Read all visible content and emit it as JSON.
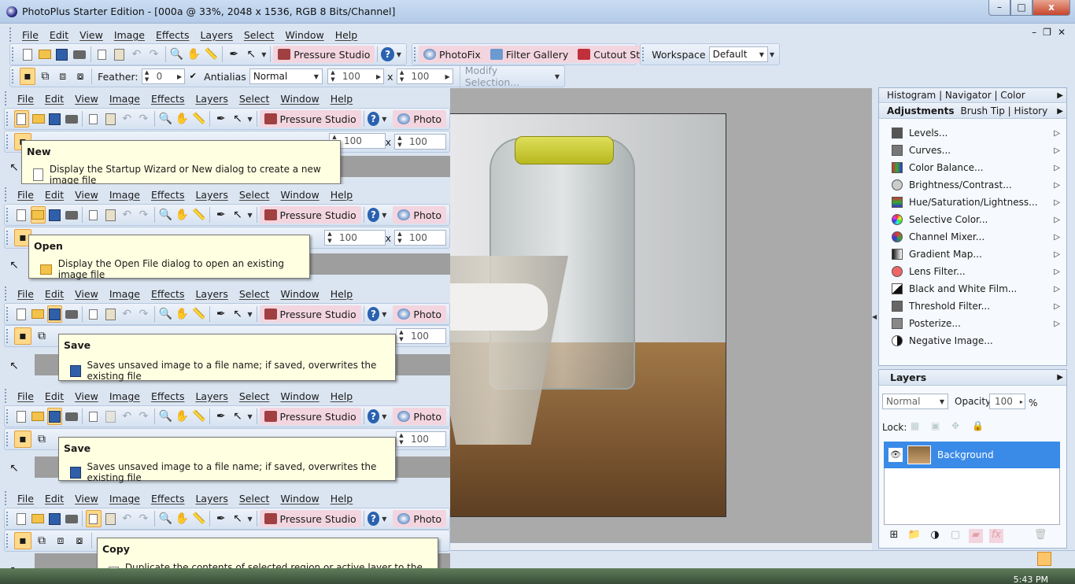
{
  "window": {
    "title": "PhotoPlus Starter Edition - [000a @ 33%, 2048 x 1536, RGB 8 Bits/Channel]"
  },
  "menu": [
    "File",
    "Edit",
    "View",
    "Image",
    "Effects",
    "Layers",
    "Select",
    "Window",
    "Help"
  ],
  "toolbar": {
    "pressure_studio": "Pressure Studio",
    "photofix": "PhotoFix",
    "filter_gallery": "Filter Gallery",
    "cutout_studio": "Cutout Studio",
    "workspace_label": "Workspace",
    "workspace_value": "Default",
    "photo_truncated": "Photo"
  },
  "context": {
    "feather_label": "Feather:",
    "feather_value": "0",
    "antialias_label": "Antialias",
    "blend_mode": "Normal",
    "width_value": "100",
    "x_sep": "x",
    "height_value": "100",
    "modify_selection": "Modify Selection...",
    "feather_truncated": "F"
  },
  "tooltips": [
    {
      "title": "New",
      "body": "Display the Startup Wizard or New dialog to create a new image file"
    },
    {
      "title": "Open",
      "body": "Display the Open File dialog to open an existing image file"
    },
    {
      "title": "Save",
      "body": "Saves unsaved image to a file name; if saved, overwrites the existing file"
    },
    {
      "title": "Save",
      "body": "Saves unsaved image to a file name; if saved, overwrites the existing file"
    },
    {
      "title": "Copy",
      "body": "Duplicate the contents of selected region or active layer to the Clipboard"
    }
  ],
  "panels": {
    "top_tabs": "Histogram | Navigator | Color",
    "adjustments_tab": "Adjustments",
    "other_tabs": "Brush Tip | History",
    "adjustments": [
      {
        "label": "Levels...",
        "color": "#555555"
      },
      {
        "label": "Curves...",
        "color": "#777777"
      },
      {
        "label": "Color Balance...",
        "color": "#3a7f3a"
      },
      {
        "label": "Brightness/Contrast...",
        "color": "#999999"
      },
      {
        "label": "Hue/Saturation/Lightness...",
        "color": "#8a4fb5"
      },
      {
        "label": "Selective Color...",
        "color": "#d03030"
      },
      {
        "label": "Channel Mixer...",
        "color": "#d07020"
      },
      {
        "label": "Gradient Map...",
        "color": "#444444"
      },
      {
        "label": "Lens Filter...",
        "color": "#e06060"
      },
      {
        "label": "Black and White Film...",
        "color": "#222222"
      },
      {
        "label": "Threshold Filter...",
        "color": "#666666"
      },
      {
        "label": "Posterize...",
        "color": "#888888"
      },
      {
        "label": "Negative Image...",
        "color": "#111111"
      }
    ],
    "layers_title": "Layers",
    "layer_blend": "Normal",
    "opacity_label": "Opacity:",
    "opacity_value": "100",
    "percent": "%",
    "lock_label": "Lock:",
    "layer_name": "Background"
  },
  "status": {
    "clock": "5:43 PM"
  }
}
